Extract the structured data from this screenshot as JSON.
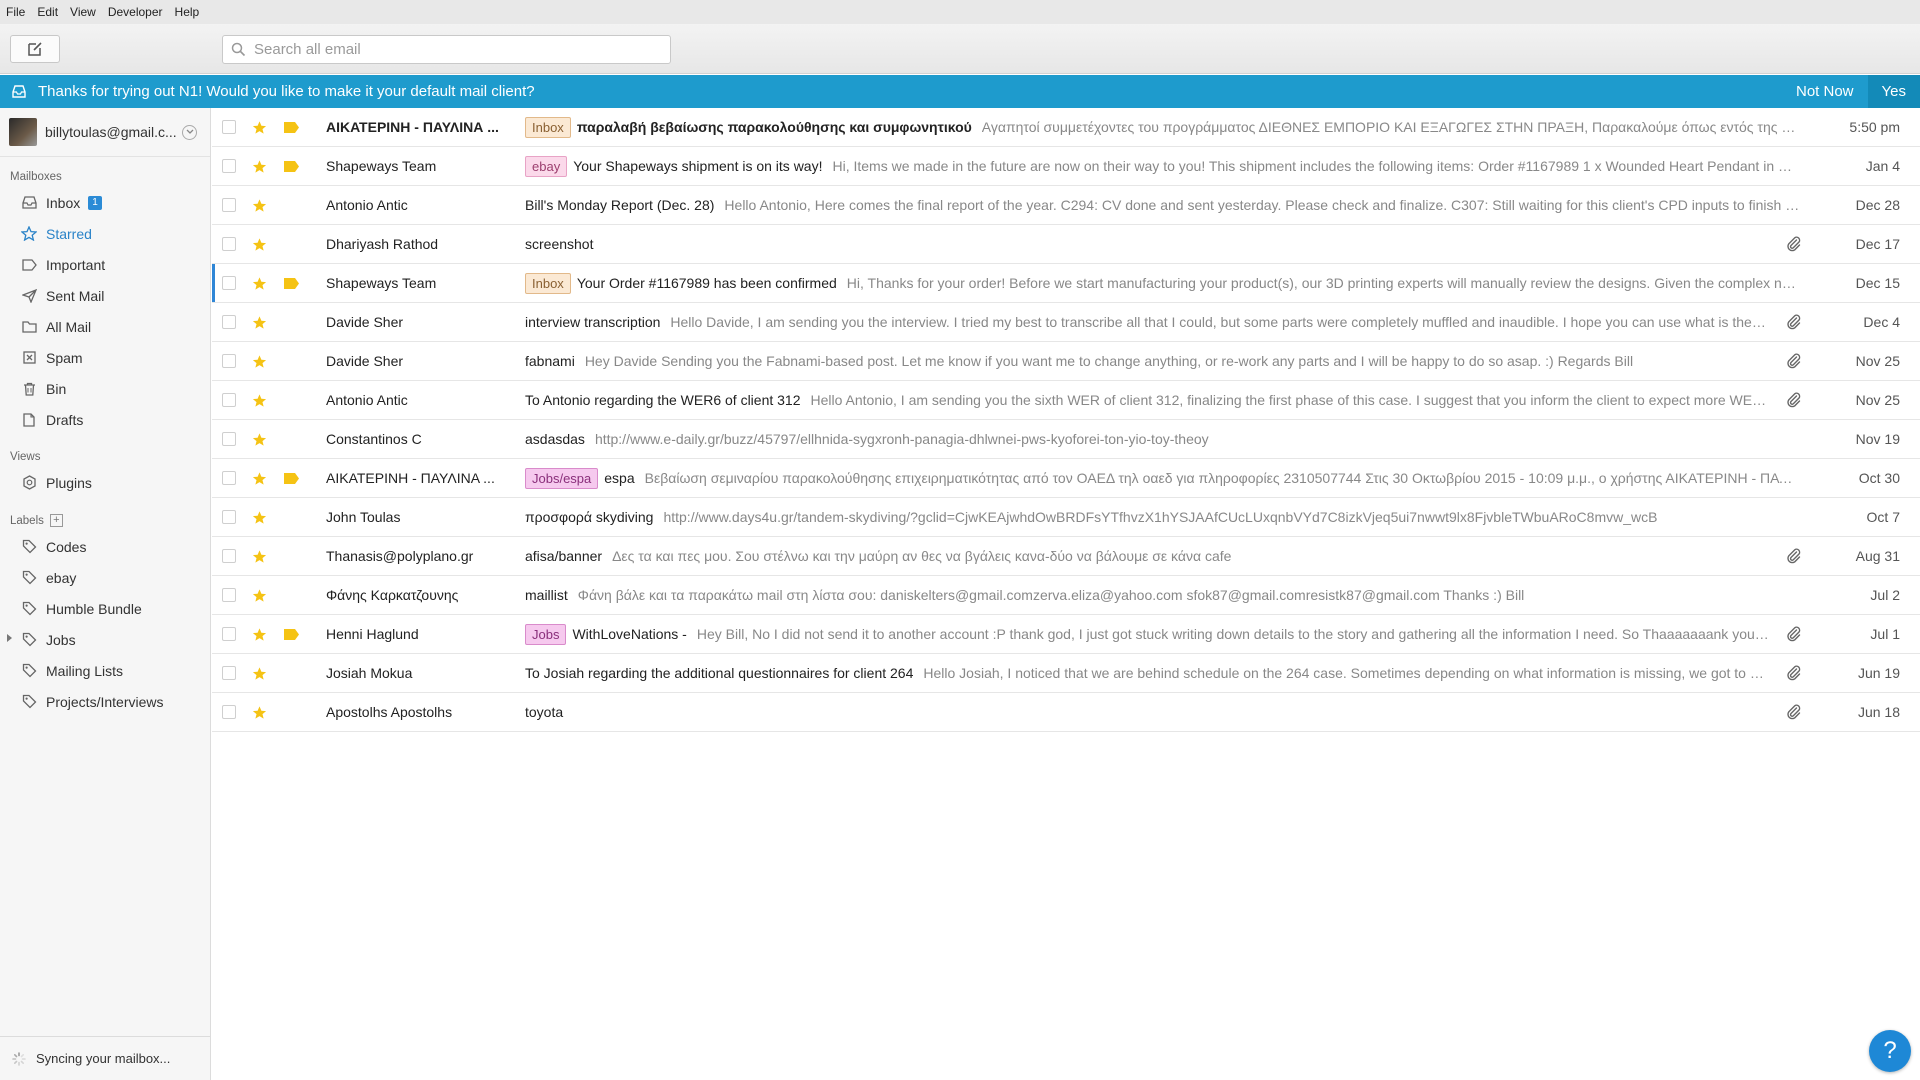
{
  "menu": [
    "File",
    "Edit",
    "View",
    "Developer",
    "Help"
  ],
  "search": {
    "placeholder": "Search all email"
  },
  "banner": {
    "message": "Thanks for trying out N1! Would you like to make it your default mail client?",
    "not_now": "Not Now",
    "yes": "Yes"
  },
  "account": {
    "email": "billytoulas@gmail.c..."
  },
  "sidebar": {
    "mailboxes_heading": "Mailboxes",
    "mailboxes": [
      {
        "label": "Inbox",
        "icon": "inbox-icon",
        "count": "1"
      },
      {
        "label": "Starred",
        "icon": "star-icon",
        "active": true
      },
      {
        "label": "Important",
        "icon": "important-icon"
      },
      {
        "label": "Sent Mail",
        "icon": "send-icon"
      },
      {
        "label": "All Mail",
        "icon": "archive-icon"
      },
      {
        "label": "Spam",
        "icon": "spam-icon"
      },
      {
        "label": "Bin",
        "icon": "trash-icon"
      },
      {
        "label": "Drafts",
        "icon": "drafts-icon"
      }
    ],
    "views_heading": "Views",
    "views": [
      {
        "label": "Plugins",
        "icon": "plugins-icon"
      }
    ],
    "labels_heading": "Labels",
    "labels": [
      {
        "label": "Codes"
      },
      {
        "label": "ebay"
      },
      {
        "label": "Humble Bundle"
      },
      {
        "label": "Jobs",
        "expandable": true
      },
      {
        "label": "Mailing Lists"
      },
      {
        "label": "Projects/Interviews"
      }
    ],
    "sync_status": "Syncing your mailbox..."
  },
  "colors": {
    "banner": "#1e9bcd",
    "accent": "#2a83c8",
    "star": "#f5c314",
    "label_inbox_bg": "#fbe9d4",
    "label_inbox_border": "#e2b98a",
    "label_inbox_text": "#8a6032",
    "label_ebay_bg": "#fbd9ea",
    "label_ebay_border": "#e8a3c6",
    "label_ebay_text": "#9c3f6f",
    "label_jobs_bg": "#f6c9ee",
    "label_jobs_border": "#d98bcb",
    "label_jobs_text": "#8a2f7b"
  },
  "threads": [
    {
      "from": "ΑΙΚΑΤΕΡΙΝΗ - ΠΑΥΛΙΝΑ ...",
      "label": "Inbox",
      "label_kind": "inbox",
      "subject": "παραλαβή βεβαίωσης παρακολούθησης και συμφωνητικού",
      "snippet": "Αγαπητοί συμμετέχοντες του προγράμματος ΔΙΕΘΝΕΣ ΕΜΠΟΡΙΟ ΚΑΙ ΕΞΑΓΩΓΕΣ ΣΤΗΝ ΠΡΑΞΗ, Παρακαλούμε όπως εντός της εβδο...",
      "date": "5:50 pm",
      "unread": true,
      "important": true,
      "attachment": false
    },
    {
      "from": "Shapeways Team",
      "label": "ebay",
      "label_kind": "ebay",
      "subject": "Your Shapeways shipment is on its way!",
      "snippet": "Hi, Items we made in the future are now on their way to you! This shipment includes the following items: Order #1167989 1 x Wounded Heart Pendant in Matt...",
      "date": "Jan 4",
      "important": true,
      "attachment": false
    },
    {
      "from": "Antonio Antic",
      "subject": "Bill's Monday Report (Dec. 28)",
      "snippet": "Hello Antonio, Here comes the final report of the year. C294: CV done and sent yesterday. Please check and finalize. C307: Still waiting for this client's CPD inputs to finish the c...",
      "date": "Dec 28",
      "attachment": false
    },
    {
      "from": "Dhariyash Rathod",
      "subject": "screenshot",
      "snippet": "",
      "date": "Dec 17",
      "attachment": true
    },
    {
      "from": "Shapeways Team",
      "label": "Inbox",
      "label_kind": "inbox",
      "subject": "Your Order #1167989 has been confirmed",
      "snippet": "Hi, Thanks for your order! Before we start manufacturing your product(s), our 3D printing experts will manually review the designs. Given the complex natu...",
      "date": "Dec 15",
      "important": true,
      "focused": true,
      "attachment": false
    },
    {
      "from": "Davide Sher",
      "subject": "interview transcription",
      "snippet": "Hello Davide, I am sending you the interview. I tried my best to transcribe all that I could, but some parts were completely muffled and inaudible. I hope you can use what is there to ...",
      "date": "Dec 4",
      "attachment": true
    },
    {
      "from": "Davide Sher",
      "subject": "fabnami",
      "snippet": "Hey Davide Sending you the Fabnami-based post. Let me know if you want me to change anything, or re-work any parts and I will be happy to do so asap. :) Regards Bill",
      "date": "Nov 25",
      "attachment": true
    },
    {
      "from": "Antonio Antic",
      "subject": "To Antonio regarding the WER6 of client 312",
      "snippet": "Hello Antonio, I am sending you the sixth WER of client 312, finalizing the first phase of this case. I suggest that you inform the client to expect more WERs fr...",
      "date": "Nov 25",
      "attachment": true
    },
    {
      "from": "Constantinos C",
      "subject": "asdasdas",
      "snippet": "http://www.e-daily.gr/buzz/45797/ellhnida-sygxronh-panagia-dhlwnei-pws-kyoforei-ton-yio-toy-theoy",
      "date": "Nov 19",
      "attachment": false
    },
    {
      "from": "ΑΙΚΑΤΕΡΙΝΗ - ΠΑΥΛΙΝΑ ...",
      "label": "Jobs/espa",
      "label_kind": "jobs",
      "subject": "espa",
      "snippet": "Βεβαίωση σεμιναρίου παρακολούθησης επιχειρηματικότητας από τον ΟΑΕΔ τηλ οαεδ για πληροφορίες 2310507744 Στις 30 Οκτωβρίου 2015 - 10:09 μ.μ., ο χρήστης ΑΙΚΑΤΕΡΙΝΗ - ΠΑΥΛΙ...",
      "date": "Oct 30",
      "important": true,
      "attachment": false
    },
    {
      "from": "John Toulas",
      "subject": "προσφορά skydiving",
      "snippet": "http://www.days4u.gr/tandem-skydiving/?gclid=CjwKEAjwhdOwBRDFsYTfhvzX1hYSJAAfCUcLUxqnbVYd7C8izkVjeq5ui7nwwt9lx8FjvbleTWbuARoC8mvw_wcB",
      "date": "Oct 7",
      "attachment": false
    },
    {
      "from": "Thanasis@polyplano.gr",
      "subject": "afisa/banner",
      "snippet": "Δες τα και πες μου. Σου στέλνω και την μαύρη αν θες να βγάλεις κανα-δύο να βάλουμε σε κάνα cafe",
      "date": "Aug 31",
      "attachment": true
    },
    {
      "from": "Φάνης Καρκατζουνης",
      "subject": "maillist",
      "snippet": "Φάνη βάλε και τα παρακάτω mail στη λίστα σου: daniskelters@gmail.comzerva.eliza@yahoo.com sfok87@gmail.comresistk87@gmail.com Thanks :) Bill",
      "date": "Jul 2",
      "attachment": false
    },
    {
      "from": "Henni Haglund",
      "label": "Jobs",
      "label_kind": "jobs",
      "subject": "WithLoveNations -",
      "snippet": "Hey Bill, No I did not send it to another account :P thank god, I just got stuck writing down details to the story and gathering all the information I need. So Thaaaaaaank you for ...",
      "date": "Jul 1",
      "important": true,
      "attachment": true
    },
    {
      "from": "Josiah Mokua",
      "subject": "To Josiah regarding the additional questionnaires for client 264",
      "snippet": "Hello Josiah, I noticed that we are behind schedule on the 264 case. Sometimes depending on what information is missing, we got to prep...",
      "date": "Jun 19",
      "attachment": true
    },
    {
      "from": "Apostolhs Apostolhs",
      "subject": "toyota",
      "snippet": "",
      "date": "Jun 18",
      "attachment": true
    }
  ],
  "help_label": "?"
}
